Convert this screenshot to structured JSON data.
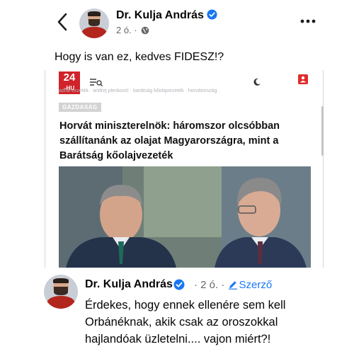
{
  "post": {
    "author": "Dr. Kulja András",
    "time": "2 ó.",
    "separator": "·",
    "text": "Hogy is van ez, kedves FIDESZ!?",
    "icons": {
      "back": "chevron-left-icon",
      "verified": "verified-badge-icon",
      "audience": "globe-icon",
      "more": "more-options-icon"
    }
  },
  "article": {
    "logo_top": "24",
    "logo_bottom": "-HU",
    "tags": "adria-vezeték · andrej plenković · barátság kőolajvezeték · horvátország",
    "section": "GAZDASÁG",
    "headline": "Horvát miniszterelnök: háromszor olcsóbban szállítanánk az olajat Magyarországra, mint a Barátság kőolajvezeték",
    "colors": {
      "brand": "#d1232a"
    }
  },
  "comment": {
    "author": "Dr. Kulja András",
    "time": "2 ó.",
    "separator": "·",
    "badge": "Szerző",
    "text": "Érdekes, hogy ennek ellenére sem kell Orbánéknak, akik csak az oroszokkal hajlandóak üzletelni.... vajon miért?!"
  },
  "colors": {
    "link_blue": "#1877f2",
    "secondary_text": "#65676b"
  }
}
